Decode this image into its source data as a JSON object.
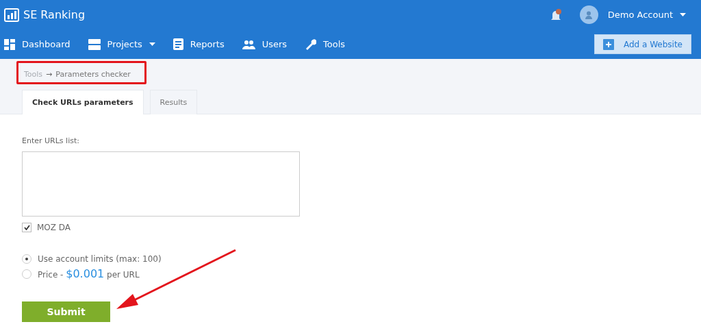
{
  "header": {
    "logo": "SE Ranking",
    "account": "Demo Account",
    "notification": true
  },
  "nav": [
    {
      "label": "Dashboard",
      "dropdown": false
    },
    {
      "label": "Projects",
      "dropdown": true
    },
    {
      "label": "Reports",
      "dropdown": false
    },
    {
      "label": "Users",
      "dropdown": false
    },
    {
      "label": "Tools",
      "dropdown": false
    }
  ],
  "add_website": "Add a Website",
  "breadcrumb": {
    "items": [
      "Tools",
      "Parameters checker"
    ],
    "separator": "→",
    "highlighted": true
  },
  "tabs": [
    {
      "label": "Check URLs parameters",
      "selected": true
    },
    {
      "label": "Results",
      "selected": false
    }
  ],
  "form": {
    "urls_label": "Enter URLs list:",
    "moz_da": {
      "label": "MOZ DA",
      "checked": true
    },
    "options": [
      {
        "kind": "limits",
        "label": "Use account limits (max: 100)",
        "selected": true
      },
      {
        "kind": "price",
        "label": "Price -",
        "price": "$0.001",
        "unit": "per URL",
        "selected": false
      }
    ],
    "submit": "Submit"
  },
  "annotation_arrow": true
}
